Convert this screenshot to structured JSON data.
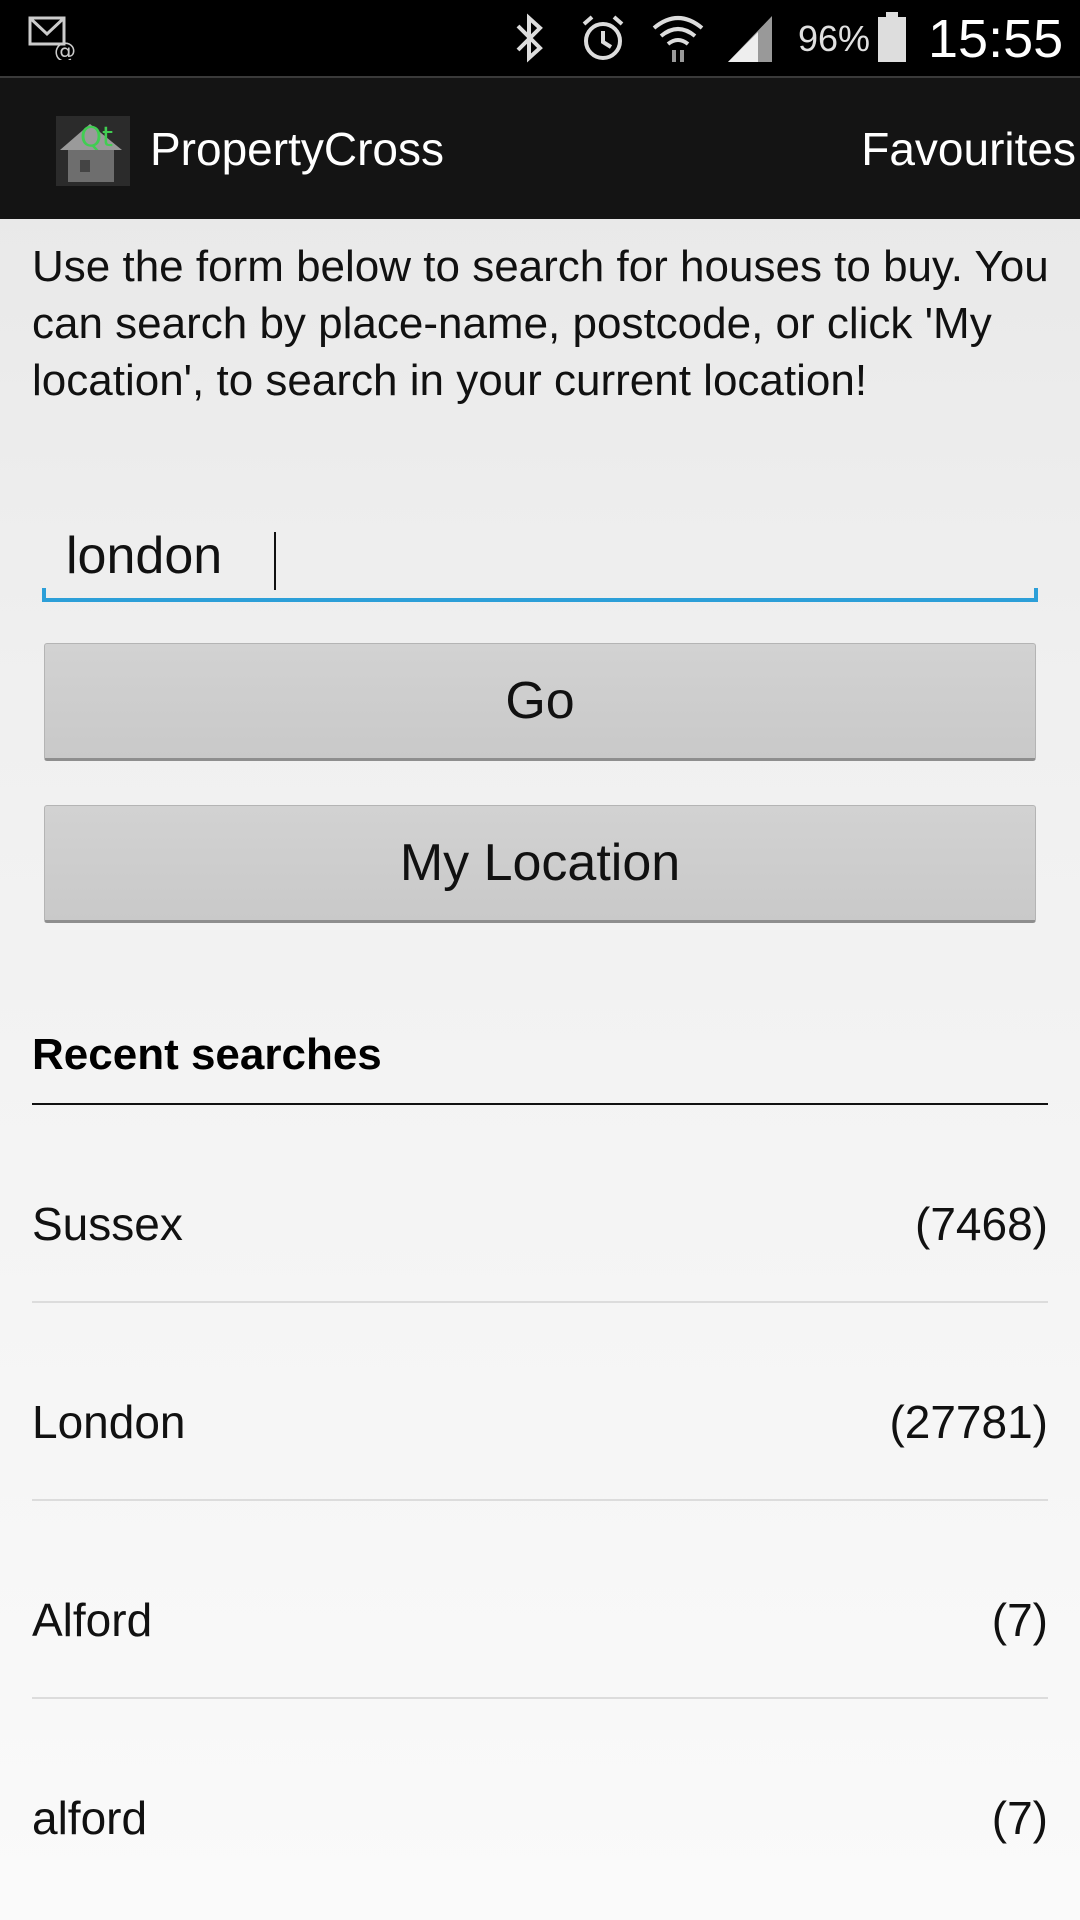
{
  "status_bar": {
    "icons": [
      "email-notification-icon",
      "bluetooth-icon",
      "alarm-icon",
      "wifi-icon",
      "signal-icon",
      "battery-icon"
    ],
    "battery_percent": "96%",
    "time": "15:55"
  },
  "action_bar": {
    "logo_text": "Qt",
    "title": "PropertyCross",
    "favourites_label": "Favourites"
  },
  "intro": {
    "text": "Use the form below to search for houses to buy. You can search by place-name, postcode, or click 'My location', to search in your current location!"
  },
  "search": {
    "value": "london",
    "accent_color": "#2c9fd8"
  },
  "buttons": {
    "go_label": "Go",
    "my_location_label": "My Location"
  },
  "recent": {
    "header": "Recent searches",
    "items": [
      {
        "name": "Sussex",
        "count": "(7468)"
      },
      {
        "name": "London",
        "count": "(27781)"
      },
      {
        "name": "Alford",
        "count": "(7)"
      },
      {
        "name": "alford",
        "count": "(7)"
      }
    ]
  }
}
